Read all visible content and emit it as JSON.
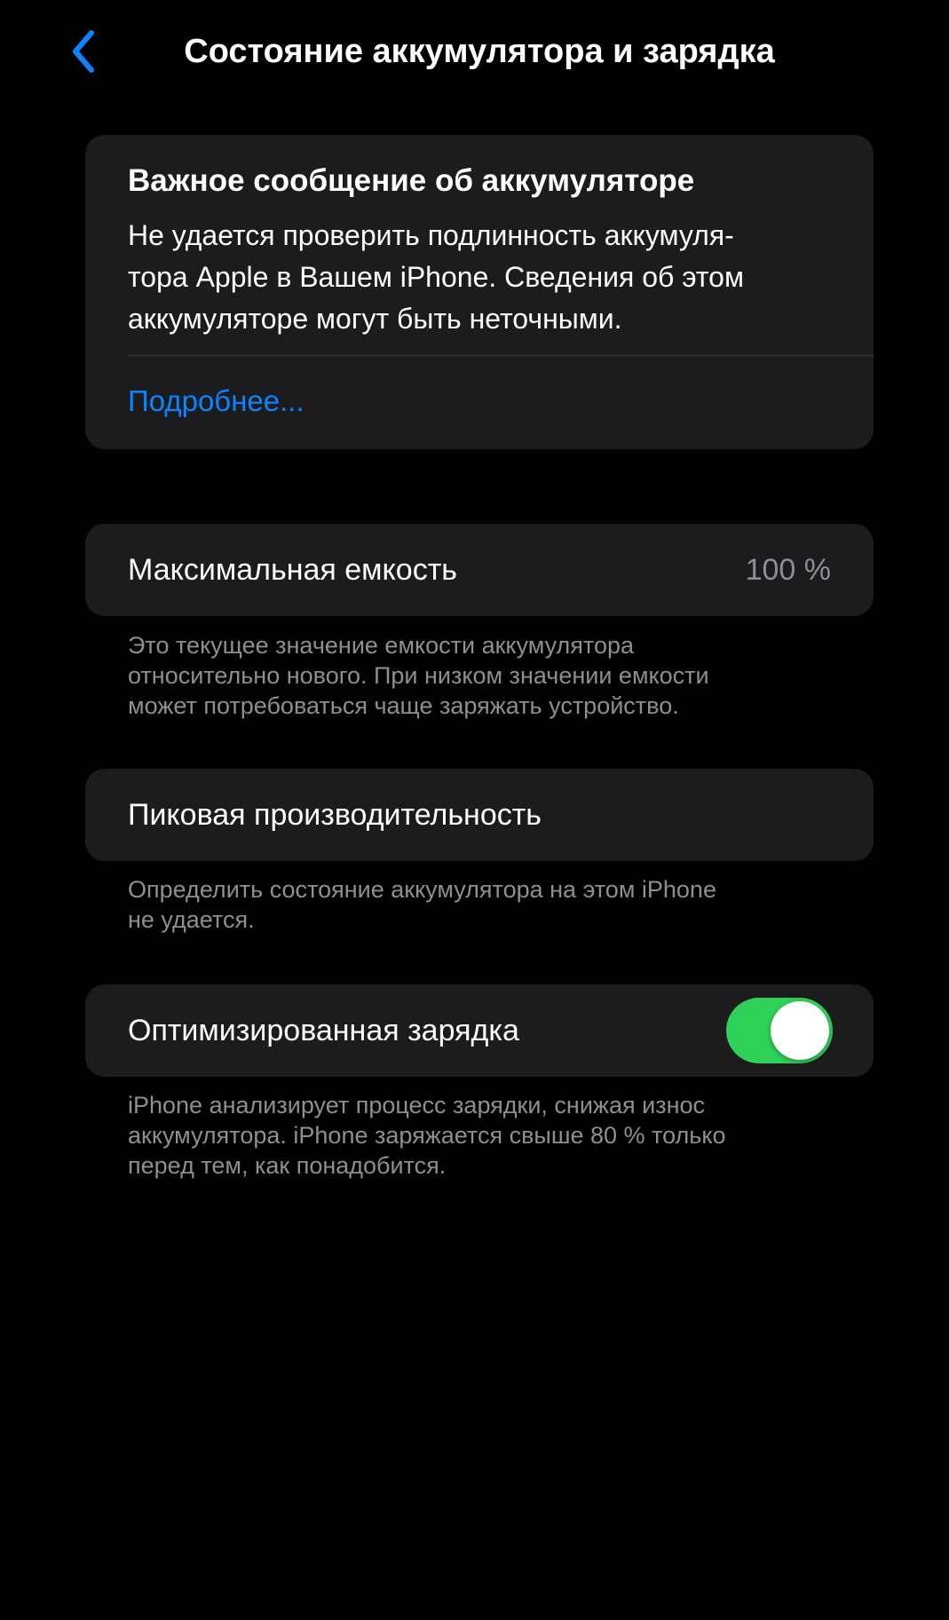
{
  "nav": {
    "title": "Состояние аккумулятора и зарядка",
    "back_icon": "chevron-left-icon"
  },
  "warning": {
    "title": "Важное сообщение об аккумуляторе",
    "body_lines": [
      "Не удается проверить подлинность аккумуля-",
      "тора Apple в Вашем iPhone. Сведения об этом",
      "аккумуляторе могут быть неточными."
    ],
    "link": "Подробнее..."
  },
  "max_capacity": {
    "label": "Максимальная емкость",
    "value": "100 %",
    "footnote_lines": [
      "Это текущее значение емкости аккумулятора",
      "относительно нового. При низком значении емкости",
      "может потребоваться чаще заряжать устройство."
    ]
  },
  "peak_performance": {
    "label": "Пиковая производительность",
    "footnote_lines": [
      "Определить состояние аккумулятора на этом iPhone",
      "не удается."
    ]
  },
  "optimized_charging": {
    "label": "Оптимизированная зарядка",
    "enabled": true,
    "footnote_lines": [
      "iPhone анализирует процесс зарядки, снижая износ",
      "аккумулятора. iPhone заряжается свыше 80 % только",
      "перед тем, как понадобится."
    ]
  },
  "colors": {
    "background": "#000000",
    "card": "#1c1c1e",
    "accent_blue": "#0a84ff",
    "toggle_green": "#30d158",
    "secondary_text": "#8e8e93"
  }
}
